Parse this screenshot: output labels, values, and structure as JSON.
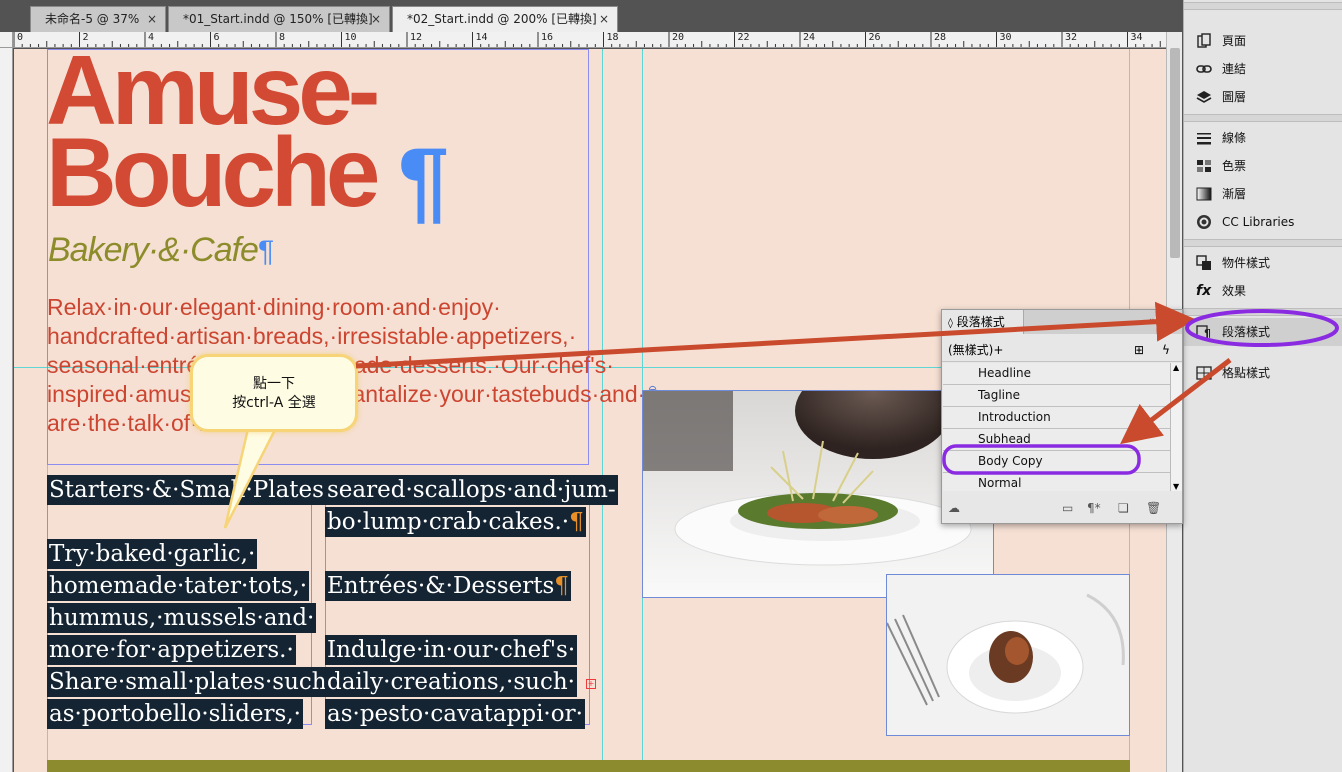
{
  "tabs": [
    {
      "label": "未命名-5 @ 37%",
      "close": "×"
    },
    {
      "label": "*01_Start.indd @ 150% [已轉換]",
      "close": "×"
    },
    {
      "label": "*02_Start.indd @ 200% [已轉換]",
      "close": "×"
    }
  ],
  "ruler": {
    "numbers": [
      "0",
      "2",
      "4",
      "6",
      "8",
      "10",
      "12",
      "14",
      "16",
      "18",
      "20",
      "22",
      "24",
      "26",
      "28",
      "30",
      "32",
      "34"
    ]
  },
  "document": {
    "headline_line1": "Amuse-",
    "headline_line2": "Bouche",
    "pilcrow": "¶",
    "tagline": "Bakery·&·Cafe",
    "intro_lines": [
      "Relax·in·our·elegant·dining·room·and·enjoy·",
      "handcrafted·artisan·breads,·irresistable·appetizers,·",
      "seasonal·entrées·and·homemade·desserts.·Our·chef's·",
      "inspired·amuse-bouches·will·tantalize·your·tastebuds·and·",
      "are·the·talk·of·the·town."
    ],
    "col1_lines": [
      "Starters·&·Small·Plates",
      "",
      "Try·baked·garlic,·",
      "homemade·tater·tots,·",
      "hummus,·mussels·and·",
      "more·for·appetizers.·",
      "Share·small·plates·such·",
      "as·portobello·sliders,·"
    ],
    "col2_lines": [
      "seared·scallops·and·jum-",
      "bo·lump·crab·cakes.·",
      "",
      "Entrées·&·Desserts",
      "",
      "Indulge·in·our·chef's·",
      "daily·creations,·such·",
      "as·pesto·cavatappi·or·"
    ]
  },
  "callout": {
    "text": "點一下\n按ctrl-A 全選"
  },
  "dock": {
    "items": [
      {
        "label": "頁面",
        "icon": "pages-icon"
      },
      {
        "label": "連結",
        "icon": "links-icon"
      },
      {
        "label": "圖層",
        "icon": "layers-icon"
      },
      {
        "label": "線條",
        "icon": "stroke-icon"
      },
      {
        "label": "色票",
        "icon": "swatches-icon"
      },
      {
        "label": "漸層",
        "icon": "gradient-icon"
      },
      {
        "label": "CC Libraries",
        "icon": "cc-libraries-icon"
      },
      {
        "label": "物件樣式",
        "icon": "object-styles-icon"
      },
      {
        "label": "效果",
        "icon": "effects-icon"
      },
      {
        "label": "段落樣式",
        "icon": "paragraph-styles-icon"
      },
      {
        "label": "格點樣式",
        "icon": "grid-styles-icon"
      }
    ]
  },
  "paragraph_styles_panel": {
    "title": "段落樣式",
    "current_style": "(無樣式)+",
    "styles": [
      "Headline",
      "Tagline",
      "Introduction",
      "Subhead",
      "Body Copy",
      "Normal"
    ],
    "selected": "Body Copy"
  },
  "colors": {
    "headline": "#d24a33",
    "tagline": "#8c8c2b",
    "highlight": "#142433",
    "annotation_arrow": "#c94a2c",
    "annotation_circle": "#8a2be2",
    "page_bg": "#f6e0d4"
  }
}
